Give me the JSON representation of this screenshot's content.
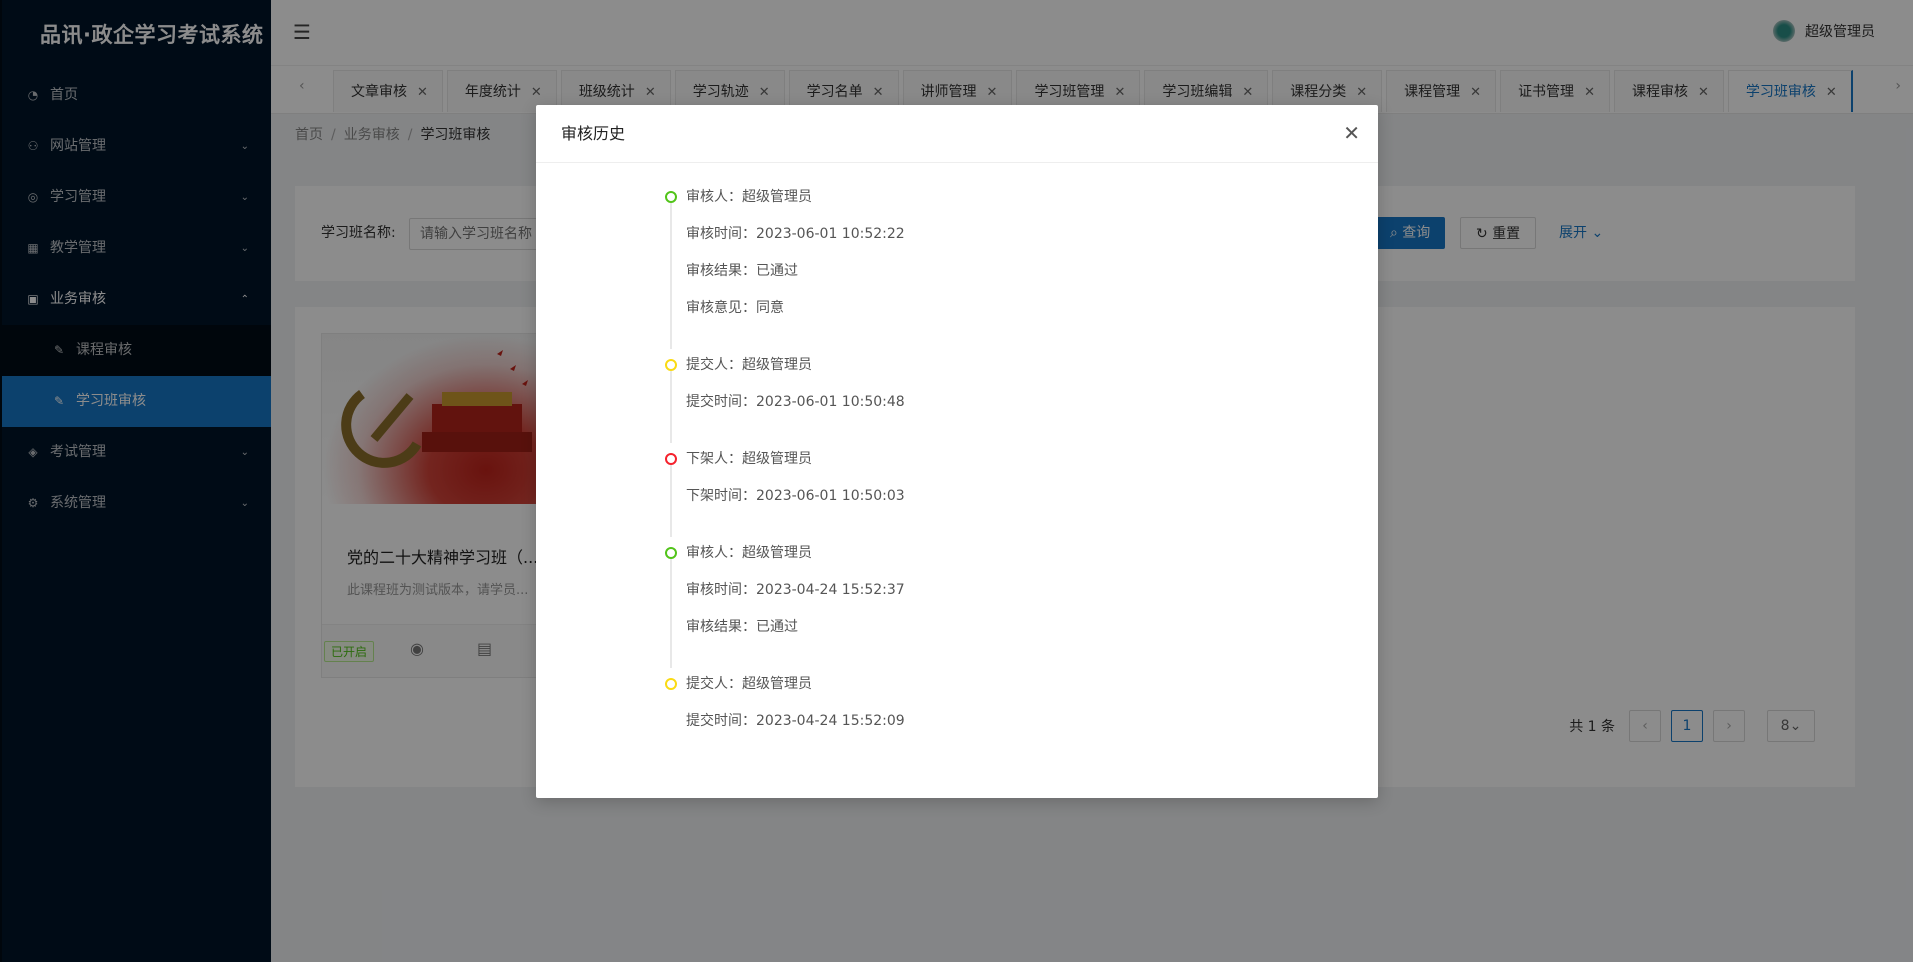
{
  "app": {
    "title": "品讯·政企学习考试系统"
  },
  "sidebar": {
    "items": [
      {
        "label": "首页",
        "icon": "dashboard-icon"
      },
      {
        "label": "网站管理",
        "icon": "sitemap-icon"
      },
      {
        "label": "学习管理",
        "icon": "study-icon"
      },
      {
        "label": "教学管理",
        "icon": "table-icon"
      },
      {
        "label": "业务审核",
        "icon": "calendar-icon"
      },
      {
        "label": "考试管理",
        "icon": "layers-icon"
      },
      {
        "label": "系统管理",
        "icon": "gear-icon"
      }
    ],
    "submenu": [
      {
        "label": "课程审核",
        "icon": "edit-icon"
      },
      {
        "label": "学习班审核",
        "icon": "edit-icon"
      }
    ]
  },
  "header": {
    "user_name": "超级管理员"
  },
  "tabs": [
    {
      "label": "文章审核"
    },
    {
      "label": "年度统计"
    },
    {
      "label": "班级统计"
    },
    {
      "label": "学习轨迹"
    },
    {
      "label": "学习名单"
    },
    {
      "label": "讲师管理"
    },
    {
      "label": "学习班管理"
    },
    {
      "label": "学习班编辑"
    },
    {
      "label": "课程分类"
    },
    {
      "label": "课程管理"
    },
    {
      "label": "证书管理"
    },
    {
      "label": "课程审核"
    },
    {
      "label": "学习班审核"
    }
  ],
  "breadcrumb": [
    "首页",
    "业务审核",
    "学习班审核"
  ],
  "search": {
    "label": "学习班名称:",
    "placeholder": "请输入学习班名称",
    "query_label": "查询",
    "reset_label": "重置",
    "expand_label": "展开"
  },
  "course": {
    "title": "党的二十大精神学习班（...",
    "desc": "此课程班为测试版本，请学员...",
    "status": "已开启"
  },
  "pagination": {
    "total": "共 1 条",
    "current": "1",
    "page_size": "8"
  },
  "modal": {
    "title": "审核历史",
    "timeline": [
      {
        "color": "#52c41a",
        "lines": [
          "审核人：超级管理员",
          "审核时间：2023-06-01 10:52:22",
          "审核结果：已通过",
          "审核意见：同意"
        ]
      },
      {
        "color": "#fadb14",
        "lines": [
          "提交人：超级管理员",
          "提交时间：2023-06-01 10:50:48"
        ]
      },
      {
        "color": "#f5222d",
        "lines": [
          "下架人：超级管理员",
          "下架时间：2023-06-01 10:50:03"
        ]
      },
      {
        "color": "#52c41a",
        "lines": [
          "审核人：超级管理员",
          "审核时间：2023-04-24 15:52:37",
          "审核结果：已通过"
        ]
      },
      {
        "color": "#fadb14",
        "lines": [
          "提交人：超级管理员",
          "提交时间：2023-04-24 15:52:09"
        ]
      }
    ]
  }
}
